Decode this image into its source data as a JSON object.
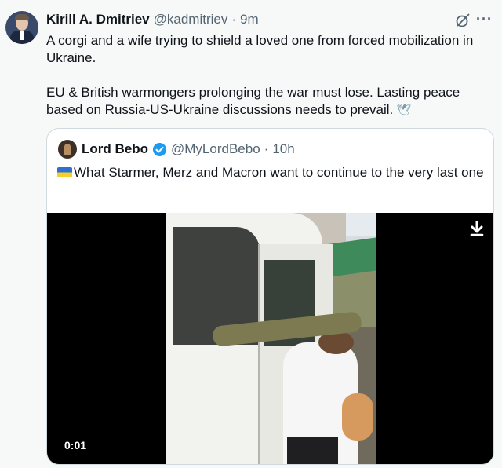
{
  "tweet": {
    "author_name": "Kirill A. Dmitriev",
    "author_handle": "@kadmitriev",
    "separator": "·",
    "time": "9m",
    "more_label": "···",
    "paragraph_1": "A corgi and a wife trying to shield a loved one from forced mobilization in Ukraine.",
    "paragraph_2": "EU & British warmongers prolonging the war must lose. Lasting peace based on Russia-US-Ukraine discussions needs to prevail.",
    "paragraph_2_emoji_icon": "dove-of-peace-icon"
  },
  "quoted": {
    "author_name": "Lord Bebo",
    "author_handle": "@MyLordBebo",
    "separator": "·",
    "time": "10h",
    "flag_icon": "ukraine-flag-icon",
    "text": "What Starmer, Merz and Macron want to continue to the very last one",
    "video": {
      "timestamp": "0:01",
      "download_icon": "download-arrow-icon"
    }
  },
  "colors": {
    "background": "#f7f9f9",
    "text": "#0f1419",
    "muted": "#536471",
    "verified": "#1d9bf0",
    "border": "#cfd9de"
  }
}
